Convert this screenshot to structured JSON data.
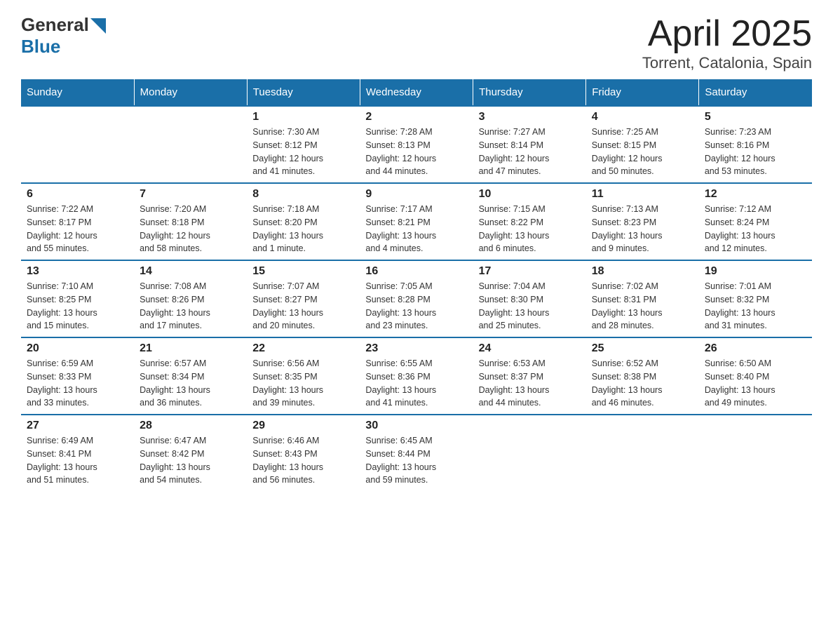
{
  "header": {
    "logo_general": "General",
    "logo_blue": "Blue",
    "title": "April 2025",
    "subtitle": "Torrent, Catalonia, Spain"
  },
  "days_of_week": [
    "Sunday",
    "Monday",
    "Tuesday",
    "Wednesday",
    "Thursday",
    "Friday",
    "Saturday"
  ],
  "weeks": [
    [
      {
        "num": "",
        "info": ""
      },
      {
        "num": "",
        "info": ""
      },
      {
        "num": "1",
        "info": "Sunrise: 7:30 AM\nSunset: 8:12 PM\nDaylight: 12 hours\nand 41 minutes."
      },
      {
        "num": "2",
        "info": "Sunrise: 7:28 AM\nSunset: 8:13 PM\nDaylight: 12 hours\nand 44 minutes."
      },
      {
        "num": "3",
        "info": "Sunrise: 7:27 AM\nSunset: 8:14 PM\nDaylight: 12 hours\nand 47 minutes."
      },
      {
        "num": "4",
        "info": "Sunrise: 7:25 AM\nSunset: 8:15 PM\nDaylight: 12 hours\nand 50 minutes."
      },
      {
        "num": "5",
        "info": "Sunrise: 7:23 AM\nSunset: 8:16 PM\nDaylight: 12 hours\nand 53 minutes."
      }
    ],
    [
      {
        "num": "6",
        "info": "Sunrise: 7:22 AM\nSunset: 8:17 PM\nDaylight: 12 hours\nand 55 minutes."
      },
      {
        "num": "7",
        "info": "Sunrise: 7:20 AM\nSunset: 8:18 PM\nDaylight: 12 hours\nand 58 minutes."
      },
      {
        "num": "8",
        "info": "Sunrise: 7:18 AM\nSunset: 8:20 PM\nDaylight: 13 hours\nand 1 minute."
      },
      {
        "num": "9",
        "info": "Sunrise: 7:17 AM\nSunset: 8:21 PM\nDaylight: 13 hours\nand 4 minutes."
      },
      {
        "num": "10",
        "info": "Sunrise: 7:15 AM\nSunset: 8:22 PM\nDaylight: 13 hours\nand 6 minutes."
      },
      {
        "num": "11",
        "info": "Sunrise: 7:13 AM\nSunset: 8:23 PM\nDaylight: 13 hours\nand 9 minutes."
      },
      {
        "num": "12",
        "info": "Sunrise: 7:12 AM\nSunset: 8:24 PM\nDaylight: 13 hours\nand 12 minutes."
      }
    ],
    [
      {
        "num": "13",
        "info": "Sunrise: 7:10 AM\nSunset: 8:25 PM\nDaylight: 13 hours\nand 15 minutes."
      },
      {
        "num": "14",
        "info": "Sunrise: 7:08 AM\nSunset: 8:26 PM\nDaylight: 13 hours\nand 17 minutes."
      },
      {
        "num": "15",
        "info": "Sunrise: 7:07 AM\nSunset: 8:27 PM\nDaylight: 13 hours\nand 20 minutes."
      },
      {
        "num": "16",
        "info": "Sunrise: 7:05 AM\nSunset: 8:28 PM\nDaylight: 13 hours\nand 23 minutes."
      },
      {
        "num": "17",
        "info": "Sunrise: 7:04 AM\nSunset: 8:30 PM\nDaylight: 13 hours\nand 25 minutes."
      },
      {
        "num": "18",
        "info": "Sunrise: 7:02 AM\nSunset: 8:31 PM\nDaylight: 13 hours\nand 28 minutes."
      },
      {
        "num": "19",
        "info": "Sunrise: 7:01 AM\nSunset: 8:32 PM\nDaylight: 13 hours\nand 31 minutes."
      }
    ],
    [
      {
        "num": "20",
        "info": "Sunrise: 6:59 AM\nSunset: 8:33 PM\nDaylight: 13 hours\nand 33 minutes."
      },
      {
        "num": "21",
        "info": "Sunrise: 6:57 AM\nSunset: 8:34 PM\nDaylight: 13 hours\nand 36 minutes."
      },
      {
        "num": "22",
        "info": "Sunrise: 6:56 AM\nSunset: 8:35 PM\nDaylight: 13 hours\nand 39 minutes."
      },
      {
        "num": "23",
        "info": "Sunrise: 6:55 AM\nSunset: 8:36 PM\nDaylight: 13 hours\nand 41 minutes."
      },
      {
        "num": "24",
        "info": "Sunrise: 6:53 AM\nSunset: 8:37 PM\nDaylight: 13 hours\nand 44 minutes."
      },
      {
        "num": "25",
        "info": "Sunrise: 6:52 AM\nSunset: 8:38 PM\nDaylight: 13 hours\nand 46 minutes."
      },
      {
        "num": "26",
        "info": "Sunrise: 6:50 AM\nSunset: 8:40 PM\nDaylight: 13 hours\nand 49 minutes."
      }
    ],
    [
      {
        "num": "27",
        "info": "Sunrise: 6:49 AM\nSunset: 8:41 PM\nDaylight: 13 hours\nand 51 minutes."
      },
      {
        "num": "28",
        "info": "Sunrise: 6:47 AM\nSunset: 8:42 PM\nDaylight: 13 hours\nand 54 minutes."
      },
      {
        "num": "29",
        "info": "Sunrise: 6:46 AM\nSunset: 8:43 PM\nDaylight: 13 hours\nand 56 minutes."
      },
      {
        "num": "30",
        "info": "Sunrise: 6:45 AM\nSunset: 8:44 PM\nDaylight: 13 hours\nand 59 minutes."
      },
      {
        "num": "",
        "info": ""
      },
      {
        "num": "",
        "info": ""
      },
      {
        "num": "",
        "info": ""
      }
    ]
  ]
}
